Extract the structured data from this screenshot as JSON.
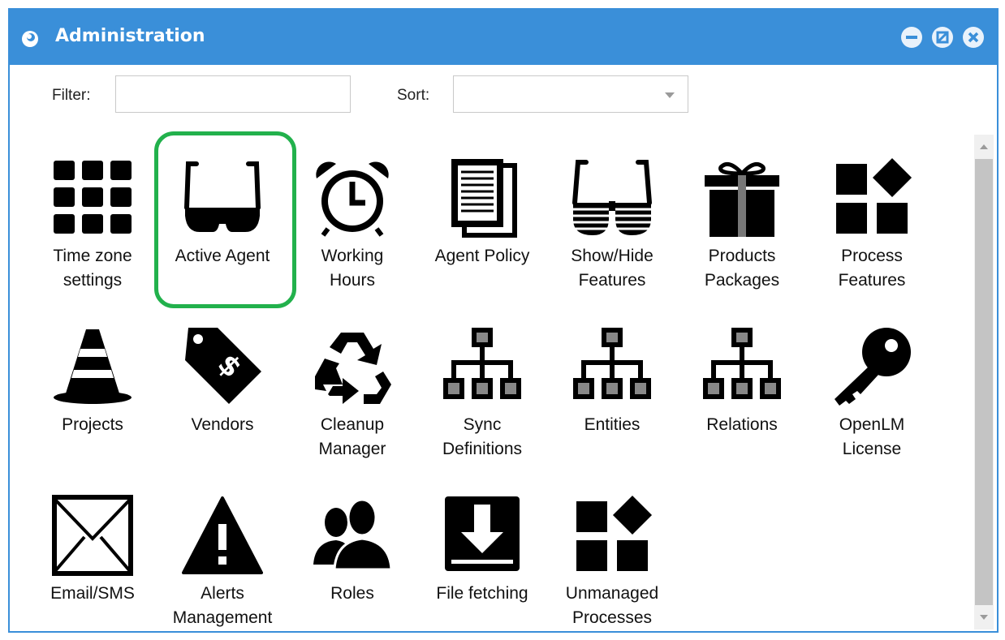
{
  "window": {
    "title": "Administration",
    "app_icon": "openlm-swirl-icon",
    "controls": [
      {
        "name": "minimize-button",
        "icon": "minus-circle-icon"
      },
      {
        "name": "maximize-button",
        "icon": "restore-circle-icon"
      },
      {
        "name": "close-button",
        "icon": "close-circle-icon"
      }
    ],
    "accent_color": "#3a8fd9"
  },
  "toolbar": {
    "filter_label": "Filter:",
    "filter_value": "",
    "filter_placeholder": "",
    "sort_label": "Sort:",
    "sort_value": ""
  },
  "tiles": [
    {
      "label": "Time zone\nsettings",
      "icon": "grid-icon"
    },
    {
      "label": "Active Agent",
      "icon": "glasses-icon",
      "highlighted": true
    },
    {
      "label": "Working\nHours",
      "icon": "alarm-clock-icon"
    },
    {
      "label": "Agent Policy",
      "icon": "document-icon"
    },
    {
      "label": "Show/Hide\nFeatures",
      "icon": "shutter-glasses-icon"
    },
    {
      "label": "Products\nPackages",
      "icon": "gift-icon"
    },
    {
      "label": "Process\nFeatures",
      "icon": "shapes-icon"
    },
    {
      "label": "Projects",
      "icon": "traffic-cone-icon"
    },
    {
      "label": "Vendors",
      "icon": "price-tag-icon"
    },
    {
      "label": "Cleanup\nManager",
      "icon": "recycle-icon"
    },
    {
      "label": "Sync\nDefinitions",
      "icon": "hierarchy-icon"
    },
    {
      "label": "Entities",
      "icon": "hierarchy-icon"
    },
    {
      "label": "Relations",
      "icon": "hierarchy-icon"
    },
    {
      "label": "OpenLM\nLicense",
      "icon": "key-icon"
    },
    {
      "label": "Email/SMS",
      "icon": "envelope-icon"
    },
    {
      "label": "Alerts\nManagement",
      "icon": "warning-icon"
    },
    {
      "label": "Roles",
      "icon": "users-icon"
    },
    {
      "label": "File fetching",
      "icon": "download-icon"
    },
    {
      "label": "Unmanaged\nProcesses",
      "icon": "shapes-icon"
    }
  ],
  "highlight_color": "#22b14c"
}
